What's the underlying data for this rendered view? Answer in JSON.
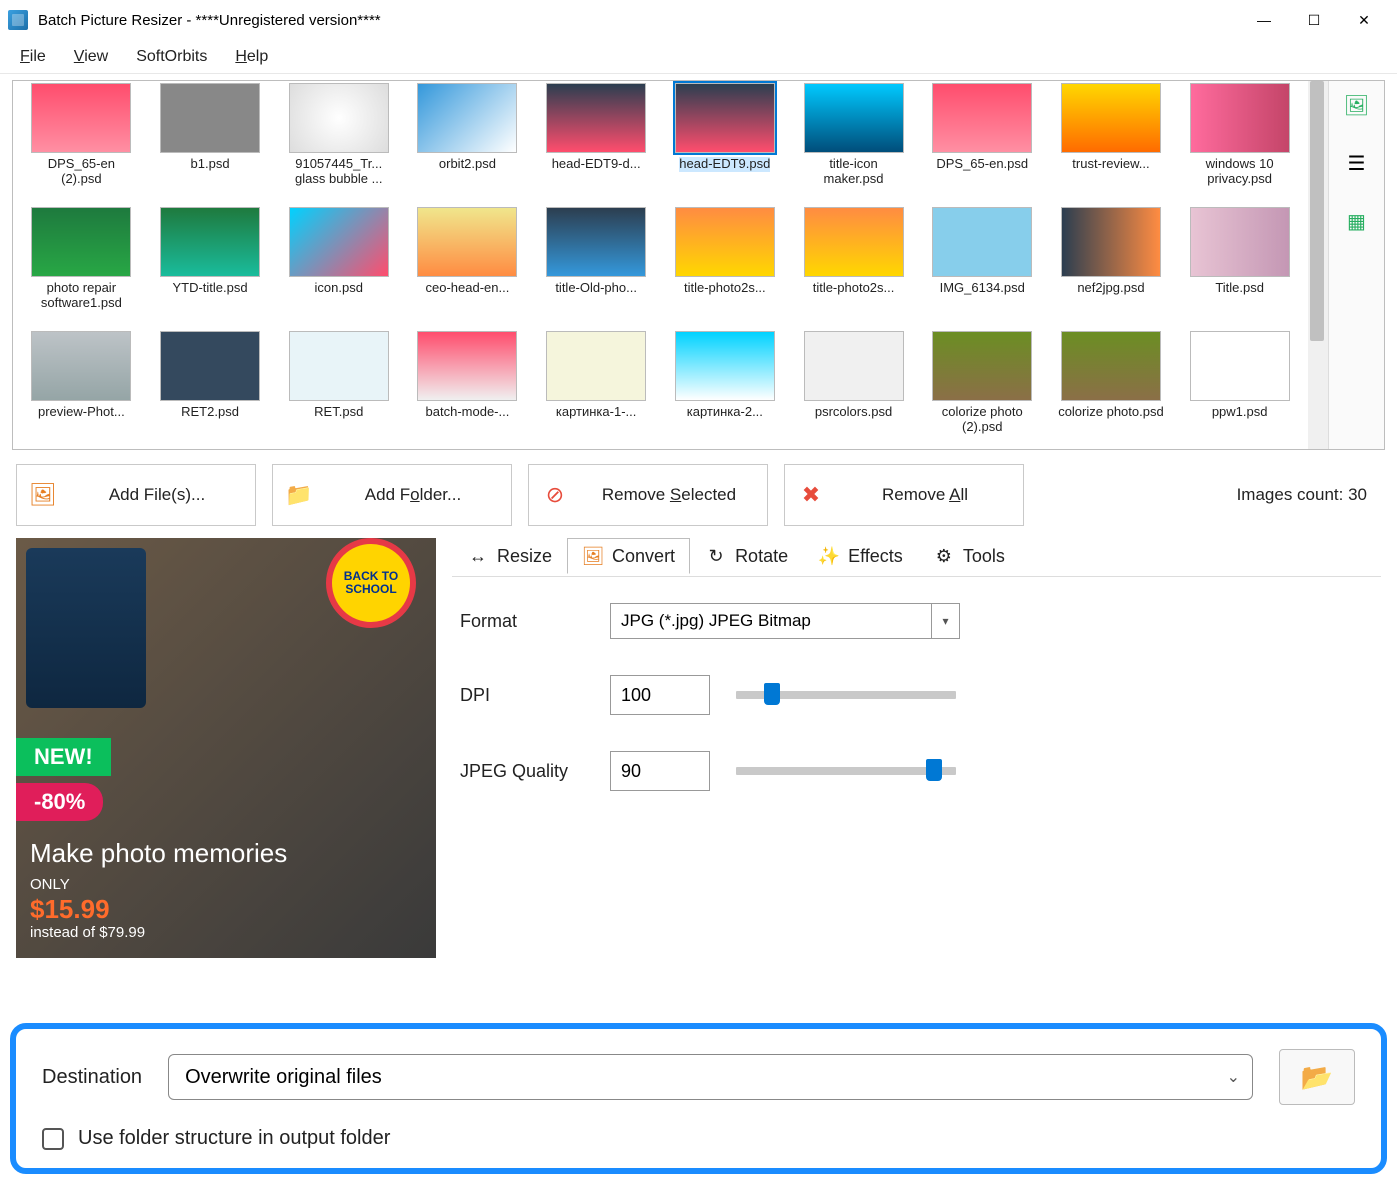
{
  "window": {
    "title": "Batch Picture Resizer - ****Unregistered version****"
  },
  "menu": {
    "file": "File",
    "view": "View",
    "softorbits": "SoftOrbits",
    "help": "Help"
  },
  "thumbs": [
    {
      "name": "DPS_65-en (2).psd",
      "cls": "t0"
    },
    {
      "name": "b1.psd",
      "cls": "t1"
    },
    {
      "name": "91057445_Tr... glass bubble ...",
      "cls": "t2"
    },
    {
      "name": "orbit2.psd",
      "cls": "t3"
    },
    {
      "name": "head-EDT9-d...",
      "cls": "t4"
    },
    {
      "name": "head-EDT9.psd",
      "cls": "t5",
      "selected": true
    },
    {
      "name": "title-icon maker.psd",
      "cls": "t6"
    },
    {
      "name": "DPS_65-en.psd",
      "cls": "t7"
    },
    {
      "name": "trust-review...",
      "cls": "t8"
    },
    {
      "name": "windows 10 privacy.psd",
      "cls": "t9"
    },
    {
      "name": "photo repair software1.psd",
      "cls": "t10"
    },
    {
      "name": "YTD-title.psd",
      "cls": "t11"
    },
    {
      "name": "icon.psd",
      "cls": "t12"
    },
    {
      "name": "ceo-head-en...",
      "cls": "t13"
    },
    {
      "name": "title-Old-pho...",
      "cls": "t14"
    },
    {
      "name": "title-photo2s...",
      "cls": "t15"
    },
    {
      "name": "title-photo2s...",
      "cls": "t16"
    },
    {
      "name": "IMG_6134.psd",
      "cls": "t17"
    },
    {
      "name": "nef2jpg.psd",
      "cls": "t18"
    },
    {
      "name": "Title.psd",
      "cls": "t19"
    },
    {
      "name": "preview-Phot...",
      "cls": "t20"
    },
    {
      "name": "RET2.psd",
      "cls": "t21"
    },
    {
      "name": "RET.psd",
      "cls": "t22"
    },
    {
      "name": "batch-mode-...",
      "cls": "t23"
    },
    {
      "name": "картинка-1-...",
      "cls": "t24"
    },
    {
      "name": "картинка-2...",
      "cls": "t25"
    },
    {
      "name": "psrcolors.psd",
      "cls": "t26"
    },
    {
      "name": "colorize photo (2).psd",
      "cls": "t27"
    },
    {
      "name": "colorize photo.psd",
      "cls": "t28"
    },
    {
      "name": "ppw1.psd",
      "cls": "t29"
    }
  ],
  "actions": {
    "add_files": "Add File(s)...",
    "add_folder": "Add Folder...",
    "remove_selected": "Remove Selected",
    "remove_all": "Remove All",
    "count_label": "Images count: 30"
  },
  "promo": {
    "bts": "BACK TO SCHOOL",
    "new": "NEW!",
    "discount": "-80%",
    "headline": "Make photo memories",
    "only": "ONLY",
    "price": "$15.99",
    "instead": "instead of $79.99"
  },
  "tabs": {
    "resize": "Resize",
    "convert": "Convert",
    "rotate": "Rotate",
    "effects": "Effects",
    "tools": "Tools"
  },
  "form": {
    "format_label": "Format",
    "format_value": "JPG (*.jpg) JPEG Bitmap",
    "dpi_label": "DPI",
    "dpi_value": "100",
    "quality_label": "JPEG Quality",
    "quality_value": "90"
  },
  "dest": {
    "label": "Destination",
    "value": "Overwrite original files",
    "checkbox_label": "Use folder structure in output folder"
  }
}
